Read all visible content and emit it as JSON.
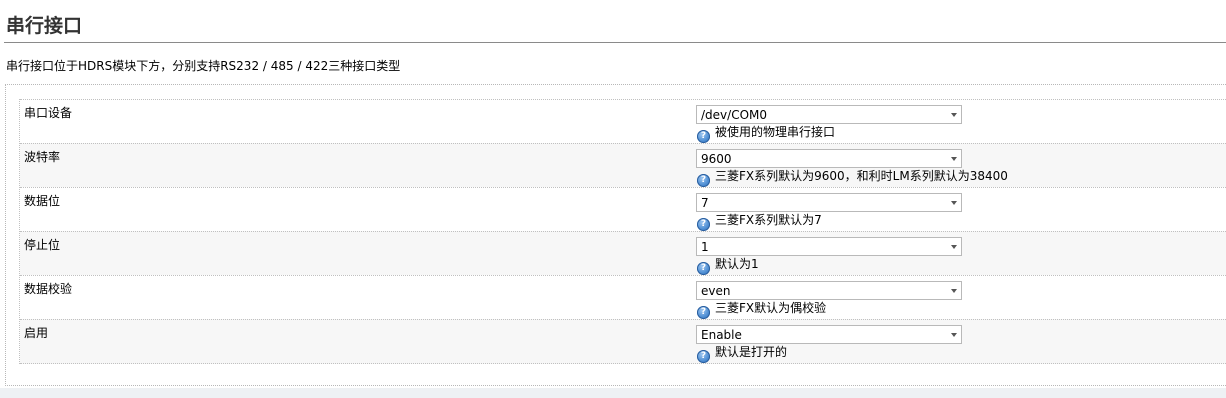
{
  "page": {
    "title": "串行接口",
    "description": "串行接口位于HDRS模块下方，分别支持RS232 / 485 / 422三种接口类型"
  },
  "rows": [
    {
      "label": "串口设备",
      "value": "/dev/COM0",
      "hint": "被使用的物理串行接口"
    },
    {
      "label": "波特率",
      "value": "9600",
      "hint": "三菱FX系列默认为9600，和利时LM系列默认为38400"
    },
    {
      "label": "数据位",
      "value": "7",
      "hint": "三菱FX系列默认为7"
    },
    {
      "label": "停止位",
      "value": "1",
      "hint": "默认为1"
    },
    {
      "label": "数据校验",
      "value": "even",
      "hint": "三菱FX默认为偶校验"
    },
    {
      "label": "启用",
      "value": "Enable",
      "hint": "默认是打开的"
    }
  ],
  "icons": {
    "help": "help-icon",
    "dropdown": "chevron-down-icon"
  },
  "colors": {
    "help_icon": "#4f8fd4",
    "border": "#b9b9b9",
    "alt_row": "#f7f7f7"
  }
}
